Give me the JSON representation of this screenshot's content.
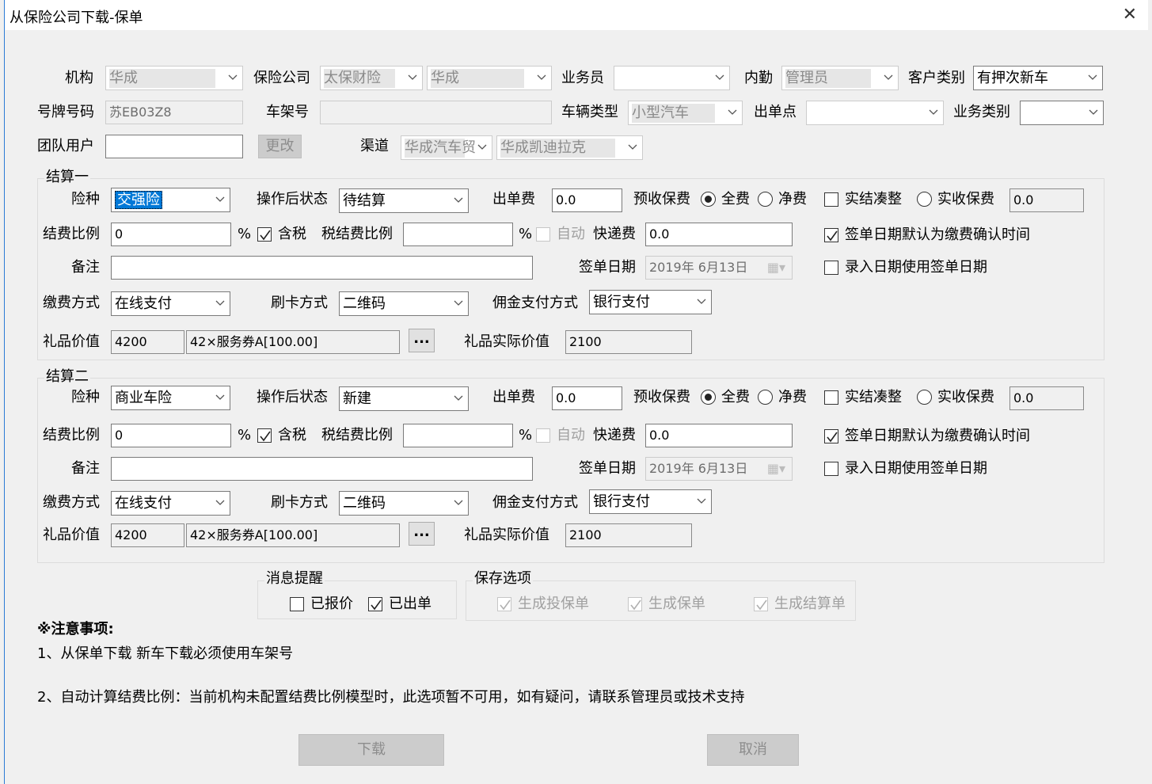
{
  "title": "从保险公司下载-保单",
  "header": {
    "org_label": "机构",
    "org": "华成",
    "insurer_label": "保险公司",
    "insurer": "太保财险",
    "insurer_branch": "华成",
    "salesman_label": "业务员",
    "salesman": "",
    "clerk_label": "内勤",
    "clerk": "管理员",
    "customer_type_label": "客户类别",
    "customer_type": "有押次新车",
    "plate_label": "号牌号码",
    "plate": "苏EB03Z8",
    "vin_label": "车架号",
    "vin": "",
    "vehicle_type_label": "车辆类型",
    "vehicle_type": "小型汽车",
    "issue_point_label": "出单点",
    "issue_point": "",
    "biz_type_label": "业务类别",
    "biz_type": "",
    "team_user_label": "团队用户",
    "team_user": "",
    "change_btn": "更改",
    "channel_label": "渠道",
    "channel1": "华成汽车贸",
    "channel2": "华成凯迪拉克"
  },
  "labels": {
    "ins_type": "险种",
    "post_status": "操作后状态",
    "issue_fee": "出单费",
    "prepaid": "预收保费",
    "full": "全费",
    "net": "净费",
    "round": "实结凑整",
    "actual_premium": "实收保费",
    "settle_ratio": "结费比例",
    "pct": "%",
    "tax_incl": "含税",
    "tax_settle_ratio": "税结费比例",
    "auto": "自动",
    "express_fee": "快递费",
    "sign_default": "签单日期默认为缴费确认时间",
    "remark": "备注",
    "sign_date": "签单日期",
    "entry_use_sign": "录入日期使用签单日期",
    "pay_method": "缴费方式",
    "card_method": "刷卡方式",
    "commission_method": "佣金支付方式",
    "gift_value": "礼品价值",
    "gift_actual": "礼品实际价值",
    "more": "..."
  },
  "s1": {
    "legend": "结算一",
    "ins_type": "交强险",
    "post_status": "待结算",
    "issue_fee": "0.0",
    "actual_premium": "0.0",
    "settle_ratio": "0",
    "tax_settle_ratio": "",
    "express_fee": "0.0",
    "remark": "",
    "sign_date": "2019年 6月13日",
    "pay_method": "在线支付",
    "card_method": "二维码",
    "commission_method": "银行支付",
    "gift_value": "4200",
    "gift_desc": "42×服务券A[100.00]",
    "gift_actual": "2100"
  },
  "s2": {
    "legend": "结算二",
    "ins_type": "商业车险",
    "post_status": "新建",
    "issue_fee": "0.0",
    "actual_premium": "0.0",
    "settle_ratio": "0",
    "tax_settle_ratio": "",
    "express_fee": "0.0",
    "remark": "",
    "sign_date": "2019年 6月13日",
    "pay_method": "在线支付",
    "card_method": "二维码",
    "commission_method": "银行支付",
    "gift_value": "4200",
    "gift_desc": "42×服务券A[100.00]",
    "gift_actual": "2100"
  },
  "msg": {
    "legend": "消息提醒",
    "quoted": "已报价",
    "issued": "已出单"
  },
  "save": {
    "legend": "保存选项",
    "gen_app": "生成投保单",
    "gen_policy": "生成保单",
    "gen_settle": "生成结算单"
  },
  "notes": {
    "title": "※注意事项:",
    "line1": "1、从保单下载 新车下载必须使用车架号",
    "line2": "2、自动计算结费比例：当前机构未配置结费比例模型时，此选项暂不可用，如有疑问，请联系管理员或技术支持"
  },
  "buttons": {
    "download": "下载",
    "cancel": "取消"
  }
}
